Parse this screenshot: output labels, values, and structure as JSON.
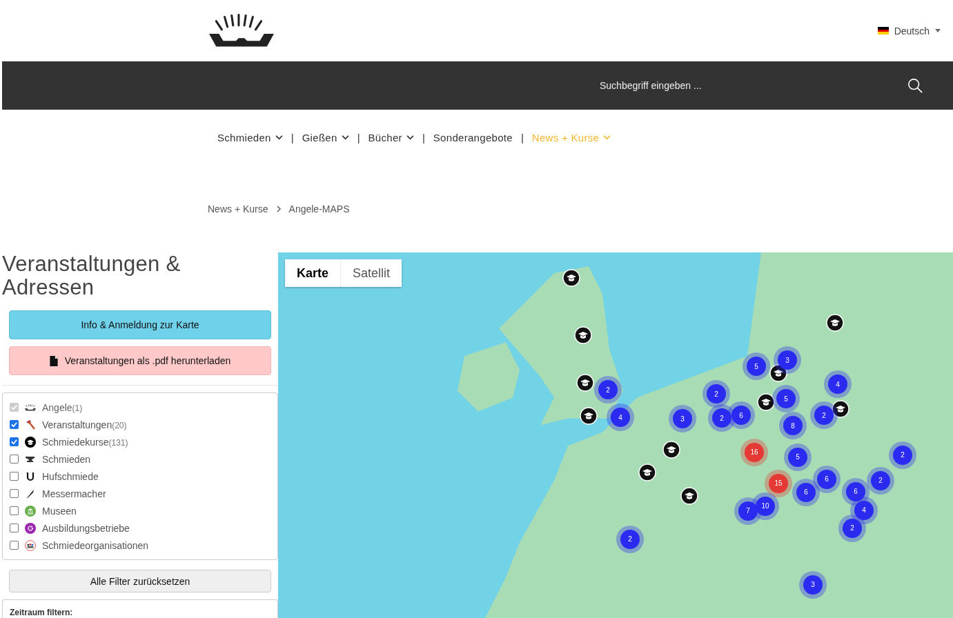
{
  "language": {
    "label": "Deutsch"
  },
  "search": {
    "placeholder": "Suchbegriff eingeben ..."
  },
  "nav": {
    "separator": "|",
    "items": [
      {
        "label": "Schmieden",
        "dropdown": true,
        "selected": false
      },
      {
        "label": "Gießen",
        "dropdown": true,
        "selected": false
      },
      {
        "label": "Bücher",
        "dropdown": true,
        "selected": false
      },
      {
        "label": "Sonderangebote",
        "dropdown": false,
        "selected": false
      },
      {
        "label": "News + Kurse",
        "dropdown": true,
        "selected": true
      }
    ]
  },
  "breadcrumb": [
    "News + Kurse",
    "Angele-MAPS"
  ],
  "sidebar": {
    "title": "Veranstaltungen & Adressen",
    "info_button": "Info & Anmeldung zur Karte",
    "pdf_button": "Veranstaltungen als .pdf herunterladen",
    "filters": [
      {
        "kind": "logo",
        "label": "Angele",
        "count": "(1)",
        "checked": true,
        "disabled": true
      },
      {
        "kind": "hammer",
        "label": "Veranstaltungen",
        "count": "(20)",
        "checked": true,
        "disabled": false
      },
      {
        "kind": "cap",
        "label": "Schmiedekurse",
        "count": "(131)",
        "checked": true,
        "disabled": false
      },
      {
        "kind": "anvil",
        "label": "Schmieden",
        "checked": false,
        "disabled": false
      },
      {
        "kind": "horseshoe",
        "label": "Hufschmiede",
        "checked": false,
        "disabled": false
      },
      {
        "kind": "knife",
        "label": "Messermacher",
        "checked": false,
        "disabled": false
      },
      {
        "kind": "museum",
        "label": "Museen",
        "checked": false,
        "disabled": false
      },
      {
        "kind": "gear",
        "label": "Ausbildungsbetriebe",
        "checked": false,
        "disabled": false
      },
      {
        "kind": "people",
        "label": "Schmiedeorganisationen",
        "checked": false,
        "disabled": false
      }
    ],
    "reset_button": "Alle Filter zurücksetzen",
    "period_label": "Zeitraum filtern:"
  },
  "map": {
    "tabs": [
      {
        "label": "Karte",
        "selected": true
      },
      {
        "label": "Satellit",
        "selected": false
      }
    ],
    "clusters": [
      {
        "count": "2",
        "color": "#2a2af0"
      },
      {
        "count": "4",
        "color": "#2a2af0"
      },
      {
        "count": "3",
        "color": "#2a2af0"
      },
      {
        "count": "2",
        "color": "#2a2af0"
      },
      {
        "count": "2",
        "color": "#2a2af0"
      },
      {
        "count": "6",
        "color": "#2a2af0"
      },
      {
        "count": "5",
        "color": "#2a2af0"
      },
      {
        "count": "3",
        "color": "#2a2af0"
      },
      {
        "count": "5",
        "color": "#2a2af0"
      },
      {
        "count": "8",
        "color": "#2a2af0"
      },
      {
        "count": "2",
        "color": "#2a2af0"
      },
      {
        "count": "4",
        "color": "#2a2af0"
      },
      {
        "count": "16",
        "color": "#e53935"
      },
      {
        "count": "15",
        "color": "#e53935"
      },
      {
        "count": "5",
        "color": "#2a2af0"
      },
      {
        "count": "6",
        "color": "#2a2af0"
      },
      {
        "count": "6",
        "color": "#2a2af0"
      },
      {
        "count": "6",
        "color": "#2a2af0"
      },
      {
        "count": "7",
        "color": "#2a2af0"
      },
      {
        "count": "10",
        "color": "#2a2af0"
      },
      {
        "count": "4",
        "color": "#2a2af0"
      },
      {
        "count": "2",
        "color": "#2a2af0"
      },
      {
        "count": "2",
        "color": "#2a2af0"
      },
      {
        "count": "2",
        "color": "#2a2af0"
      },
      {
        "count": "2",
        "color": "#2a2af0"
      },
      {
        "count": "3",
        "color": "#2a2af0"
      }
    ]
  }
}
